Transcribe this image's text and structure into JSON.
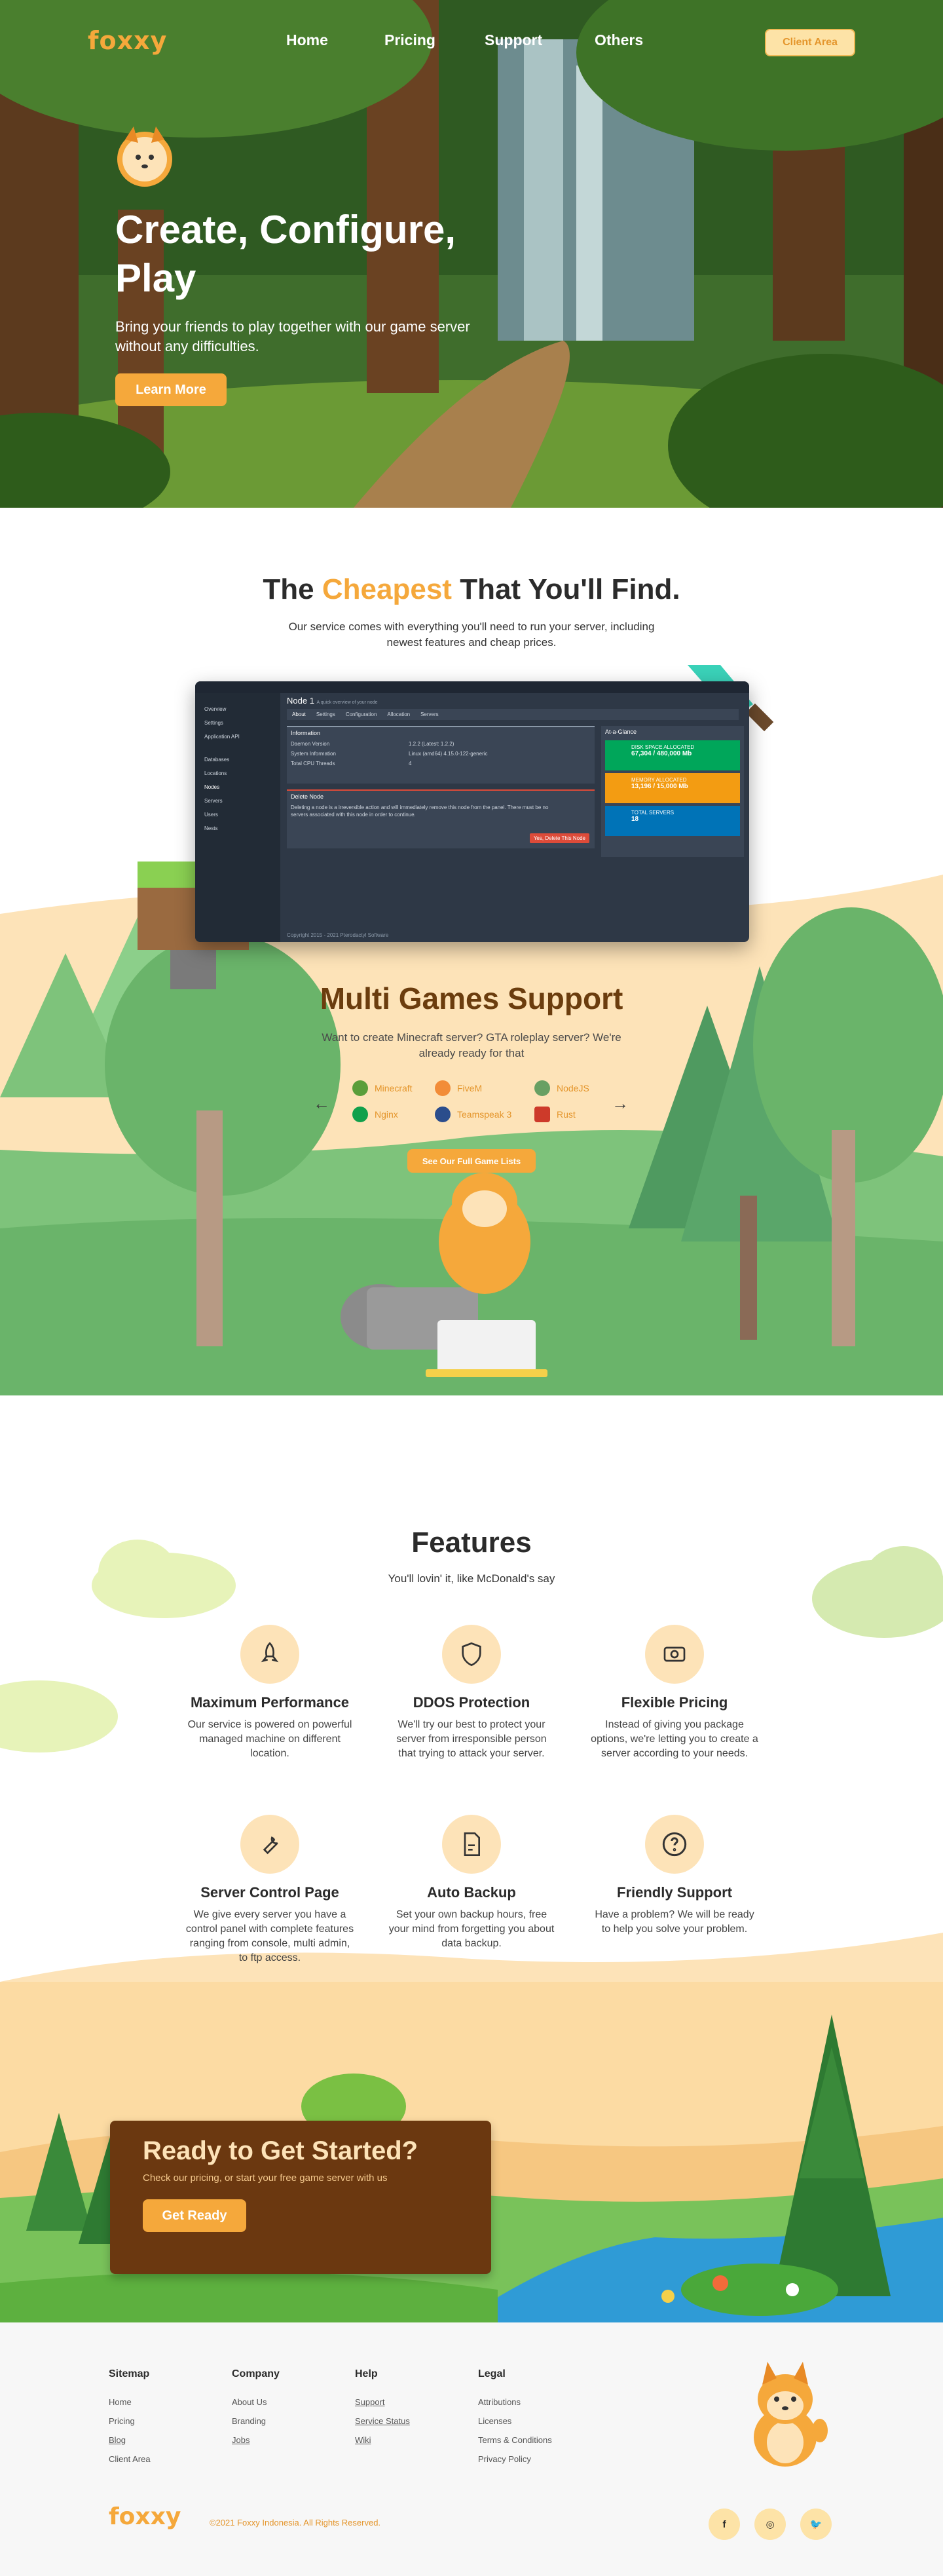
{
  "brand": {
    "name": "foxxy"
  },
  "nav": {
    "links": [
      "Home",
      "Pricing",
      "Support",
      "Others"
    ],
    "client_area": "Client Area"
  },
  "hero": {
    "title": "Create, Configure, Play",
    "subtitle": "Bring your friends to play together with our game server without any difficulties.",
    "cta": "Learn More"
  },
  "cheapest": {
    "title_pre": "The",
    "title_highlight": "Cheapest",
    "title_post": "That You'll Find.",
    "subtitle": "Our service comes with everything you'll need to run your server, including newest features and cheap prices."
  },
  "panel": {
    "title": "Node 1",
    "title_sub": "A quick overview of your node",
    "tabs": [
      "About",
      "Settings",
      "Configuration",
      "Allocation",
      "Servers"
    ],
    "sidebar": [
      "Overview",
      "Settings",
      "Application API",
      "Databases",
      "Locations",
      "Nodes",
      "Servers",
      "Users",
      "Nests"
    ],
    "info_title": "Information",
    "info_rows": [
      {
        "label": "Daemon Version",
        "value": "1.2.2 (Latest: 1.2.2)"
      },
      {
        "label": "System Information",
        "value": "Linux (amd64) 4.15.0-122-generic"
      },
      {
        "label": "Total CPU Threads",
        "value": "4"
      }
    ],
    "delete_title": "Delete Node",
    "delete_text": "Deleting a node is a irreversible action and will immediately remove this node from the panel. There must be no servers associated with this node in order to continue.",
    "delete_btn": "Yes, Delete This Node",
    "glance_title": "At-a-Glance",
    "glance": [
      {
        "label": "DISK SPACE ALLOCATED",
        "value": "67,304 / 480,000 Mb",
        "color": "#00a65a"
      },
      {
        "label": "MEMORY ALLOCATED",
        "value": "13,196 / 15,000 Mb",
        "color": "#f39c12"
      },
      {
        "label": "TOTAL SERVERS",
        "value": "18",
        "color": "#0073b7"
      }
    ],
    "footer": "Copyright 2015 - 2021 Pterodactyl Software"
  },
  "games": {
    "title": "Multi Games Support",
    "subtitle": "Want to create Minecraft server? GTA roleplay server? We're already ready for that",
    "items": [
      {
        "name": "Minecraft",
        "color": "#5a9e3a"
      },
      {
        "name": "FiveM",
        "color": "#f28c38"
      },
      {
        "name": "NodeJS",
        "color": "#68a063"
      },
      {
        "name": "Nginx",
        "color": "#11a04b"
      },
      {
        "name": "Teamspeak 3",
        "color": "#2b4d8c"
      },
      {
        "name": "Rust",
        "color": "#cd3a2a"
      }
    ],
    "cta": "See Our Full Game Lists"
  },
  "features": {
    "title": "Features",
    "subtitle": "You'll lovin' it, like McDonald's say",
    "items": [
      {
        "name": "Maximum Performance",
        "desc": "Our service is powered on powerful managed machine on different location.",
        "icon": "rocket-icon"
      },
      {
        "name": "DDOS Protection",
        "desc": "We'll try our best to protect your server from irresponsible person that trying to attack your server.",
        "icon": "shield-icon"
      },
      {
        "name": "Flexible Pricing",
        "desc": "Instead of giving you package options, we're letting you to create a server according to your needs.",
        "icon": "money-icon"
      },
      {
        "name": "Server Control Page",
        "desc": "We give every server you have a control panel with complete features ranging from console, multi admin, to ftp access.",
        "icon": "wrench-icon"
      },
      {
        "name": "Auto Backup",
        "desc": "Set your own backup hours, free your mind from forgetting you about data backup.",
        "icon": "document-icon"
      },
      {
        "name": "Friendly Support",
        "desc": "Have a problem? We will be ready to help you solve your problem.",
        "icon": "help-icon"
      }
    ]
  },
  "ready": {
    "title": "Ready to Get Started?",
    "subtitle": "Check our pricing, or start your free game server with us",
    "cta": "Get Ready"
  },
  "footer": {
    "columns": [
      {
        "title": "Sitemap",
        "links": [
          "Home",
          "Pricing",
          "Blog",
          "Client Area"
        ]
      },
      {
        "title": "Company",
        "links": [
          "About Us",
          "Branding",
          "Jobs"
        ]
      },
      {
        "title": "Help",
        "links": [
          "Support",
          "Service Status",
          "Wiki"
        ]
      },
      {
        "title": "Legal",
        "links": [
          "Attributions",
          "Licenses",
          "Terms & Conditions",
          "Privacy Policy"
        ]
      }
    ],
    "copyright": "©2021 Foxxy Indonesia. All Rights Reserved.",
    "social": [
      {
        "name": "facebook-icon",
        "glyph": "f"
      },
      {
        "name": "instagram-icon",
        "glyph": "◎"
      },
      {
        "name": "twitter-icon",
        "glyph": "🐦"
      }
    ]
  }
}
